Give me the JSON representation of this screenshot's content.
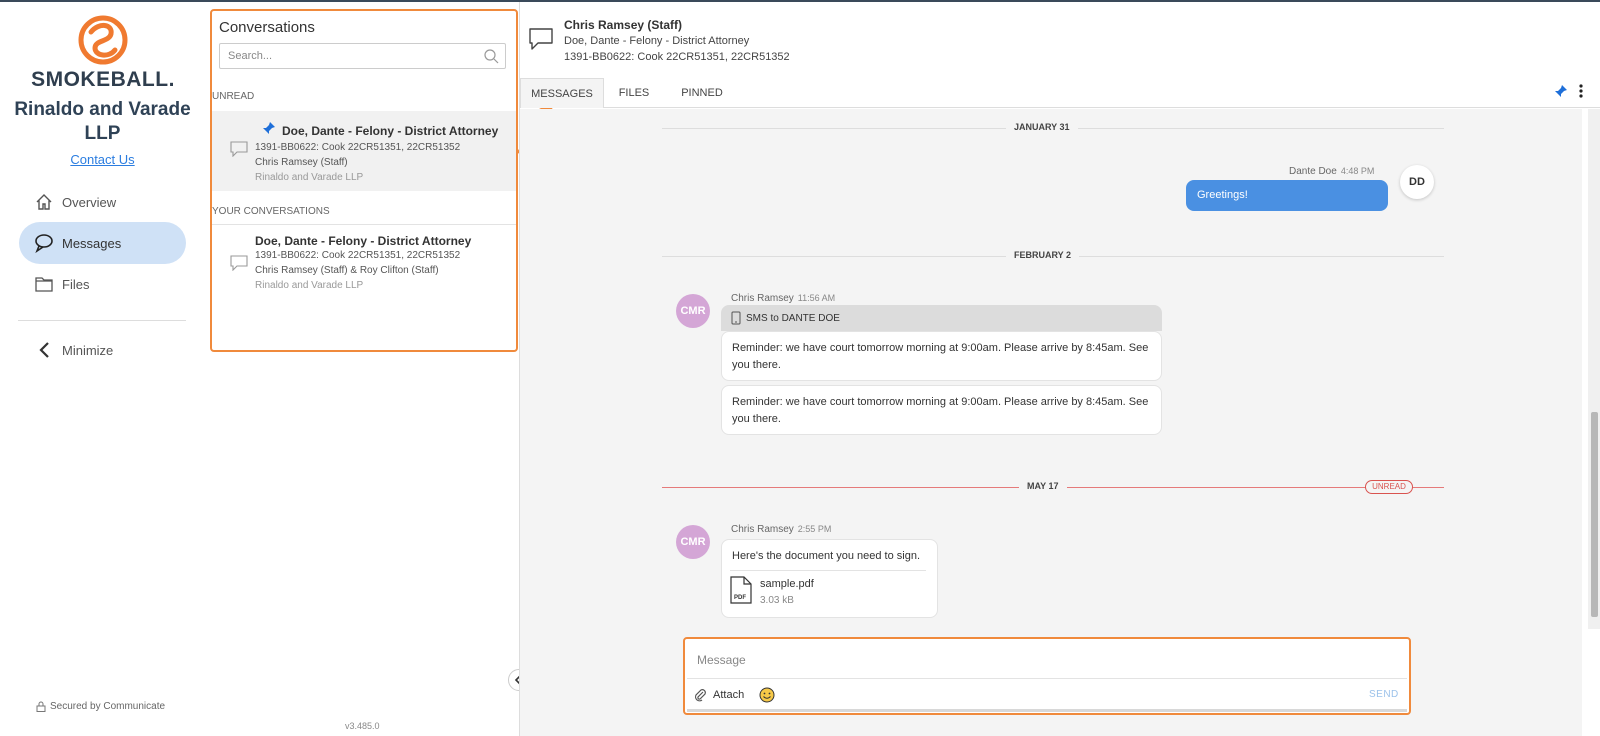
{
  "nav": {
    "logo_text": "SMOKEBALL.",
    "firm_name": "Rinaldo and Varade LLP",
    "contact_label": "Contact Us",
    "items": [
      {
        "label": "Overview",
        "icon": "home-icon"
      },
      {
        "label": "Messages",
        "icon": "chat-icon"
      },
      {
        "label": "Files",
        "icon": "folder-icon"
      }
    ],
    "minimize_label": "Minimize",
    "secured_label": "Secured by Communicate",
    "version": "v3.485.0"
  },
  "conversations": {
    "title": "Conversations",
    "search_placeholder": "Search...",
    "unread_label": "UNREAD",
    "yours_label": "YOUR CONVERSATIONS",
    "items": [
      {
        "title": "Doe, Dante - Felony - District Attorney",
        "case": "1391-BB0622: Cook 22CR51351, 22CR51352",
        "people": "Chris Ramsey (Staff)",
        "firm": "Rinaldo and Varade LLP"
      },
      {
        "title": "Doe, Dante - Felony - District Attorney",
        "case": "1391-BB0622: Cook 22CR51351, 22CR51352",
        "people": "Chris Ramsey (Staff) & Roy Clifton (Staff)",
        "firm": "Rinaldo and Varade LLP"
      }
    ]
  },
  "header": {
    "name": "Chris Ramsey (Staff)",
    "line2": "Doe, Dante - Felony - District Attorney",
    "line3": "1391-BB0622: Cook 22CR51351, 22CR51352"
  },
  "tabs": [
    "MESSAGES",
    "FILES",
    "PINNED"
  ],
  "feed": {
    "dates": [
      "JANUARY 31",
      "FEBRUARY 2",
      "MAY 17"
    ],
    "unread_badge": "UNREAD",
    "msg1": {
      "sender": "Dante Doe",
      "time": "4:48 PM",
      "initials": "DD",
      "text": "Greetings!"
    },
    "msg2": {
      "sender": "Chris Ramsey",
      "time": "11:56 AM",
      "initials": "CMR",
      "sms_label": "SMS to DANTE DOE",
      "texts": [
        "Reminder: we have court tomorrow morning at 9:00am. Please arrive by 8:45am. See you there.",
        "Reminder: we have court tomorrow morning at 9:00am. Please arrive by 8:45am. See you there."
      ]
    },
    "msg3": {
      "sender": "Chris Ramsey",
      "time": "2:55 PM",
      "initials": "CMR",
      "text": "Here's the document you need to sign.",
      "file_name": "sample.pdf",
      "file_size": "3.03 kB",
      "file_badge": "PDF"
    }
  },
  "composer": {
    "placeholder": "Message",
    "attach_label": "Attach",
    "send_label": "SEND"
  },
  "colors": {
    "accent_orange": "#f08a3c",
    "brand_blue": "#4a90e2",
    "avatar_purple": "#d4a6d6",
    "unread_red": "#d9534f",
    "nav_active": "#cfe1f6"
  }
}
